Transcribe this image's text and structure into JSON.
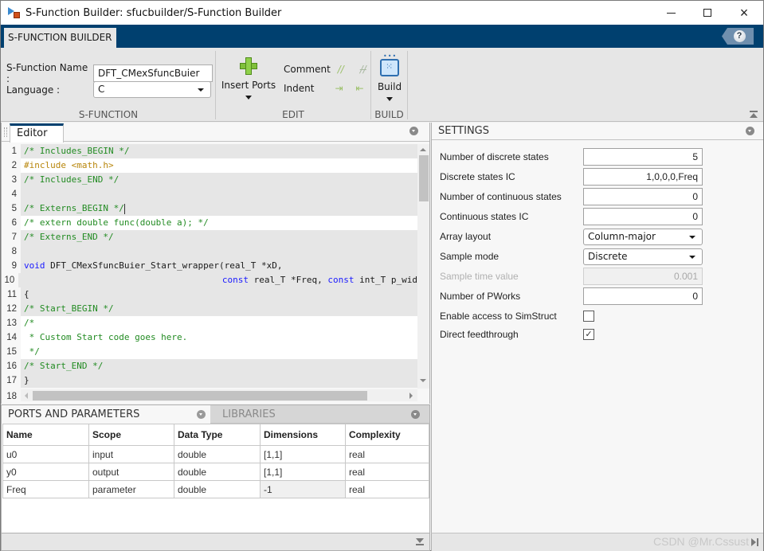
{
  "window": {
    "title": "S-Function Builder: sfucbuilder/S-Function Builder",
    "controls": {
      "minimize": "minimize",
      "maximize": "maximize",
      "close": "×"
    }
  },
  "ribbon": {
    "tab": "S-FUNCTION BUILDER",
    "help": "?",
    "sfunction": {
      "section_label": "S-FUNCTION",
      "name_label": "S-Function Name :",
      "name_value": "DFT_CMexSfuncBuier",
      "language_label": "Language :",
      "language_value": "C"
    },
    "edit": {
      "section_label": "EDIT",
      "insert_ports": "Insert Ports",
      "comment": "Comment",
      "indent": "Indent",
      "comment_icon": "//",
      "uncomment_icon": "//",
      "indent_icon": "⇥",
      "outdent_icon": "⇤"
    },
    "build": {
      "section_label": "BUILD",
      "label": "Build"
    }
  },
  "editor": {
    "tab": "Editor",
    "lines": [
      {
        "n": "1",
        "text": "/* Includes_BEGIN */"
      },
      {
        "n": "2",
        "text": "#include <math.h>"
      },
      {
        "n": "3",
        "text": "/* Includes_END */"
      },
      {
        "n": "4",
        "text": ""
      },
      {
        "n": "5",
        "text": "/* Externs_BEGIN */"
      },
      {
        "n": "6",
        "text": "/* extern double func(double a); */"
      },
      {
        "n": "7",
        "text": "/* Externs_END */"
      },
      {
        "n": "8",
        "text": ""
      },
      {
        "n": "9",
        "kw": "void",
        "text": " DFT_CMexSfuncBuier_Start_wrapper(real_T *xD,"
      },
      {
        "n": "10",
        "indent": "                                      ",
        "kw1": "const",
        "t1": " real_T *Freq, ",
        "kw2": "const",
        "t2": " int_T p_wid"
      },
      {
        "n": "11",
        "text": "{"
      },
      {
        "n": "12",
        "text": "/* Start_BEGIN */"
      },
      {
        "n": "13",
        "text": "/*"
      },
      {
        "n": "14",
        "text": " * Custom Start code goes here."
      },
      {
        "n": "15",
        "text": " */"
      },
      {
        "n": "16",
        "text": "/* Start_END */"
      },
      {
        "n": "17",
        "text": "}"
      },
      {
        "n": "18",
        "text": ""
      }
    ]
  },
  "ports": {
    "tab": "PORTS AND PARAMETERS",
    "libraries_tab": "LIBRARIES",
    "columns": [
      "Name",
      "Scope",
      "Data Type",
      "Dimensions",
      "Complexity"
    ],
    "rows": [
      [
        "u0",
        "input",
        "double",
        "[1,1]",
        "real"
      ],
      [
        "y0",
        "output",
        "double",
        "[1,1]",
        "real"
      ],
      [
        "Freq",
        "parameter",
        "double",
        "-1",
        "real"
      ]
    ]
  },
  "settings": {
    "title": "SETTINGS",
    "num_discrete_states": {
      "label": "Number of discrete states",
      "value": "5"
    },
    "discrete_states_ic": {
      "label": "Discrete states IC",
      "value": "1,0,0,0,Freq"
    },
    "num_continuous_states": {
      "label": "Number of continuous states",
      "value": "0"
    },
    "continuous_states_ic": {
      "label": "Continuous states IC",
      "value": "0"
    },
    "array_layout": {
      "label": "Array layout",
      "value": "Column-major"
    },
    "sample_mode": {
      "label": "Sample mode",
      "value": "Discrete"
    },
    "sample_time": {
      "label": "Sample time value",
      "value": "0.001"
    },
    "num_pworks": {
      "label": "Number of PWorks",
      "value": "0"
    },
    "simstruct": {
      "label": "Enable access to SimStruct",
      "checked": false,
      "mark": ""
    },
    "direct_feedthrough": {
      "label": "Direct feedthrough",
      "checked": true,
      "mark": "✓"
    }
  },
  "status": {
    "watermark": "CSDN @Mr.Cssust"
  }
}
